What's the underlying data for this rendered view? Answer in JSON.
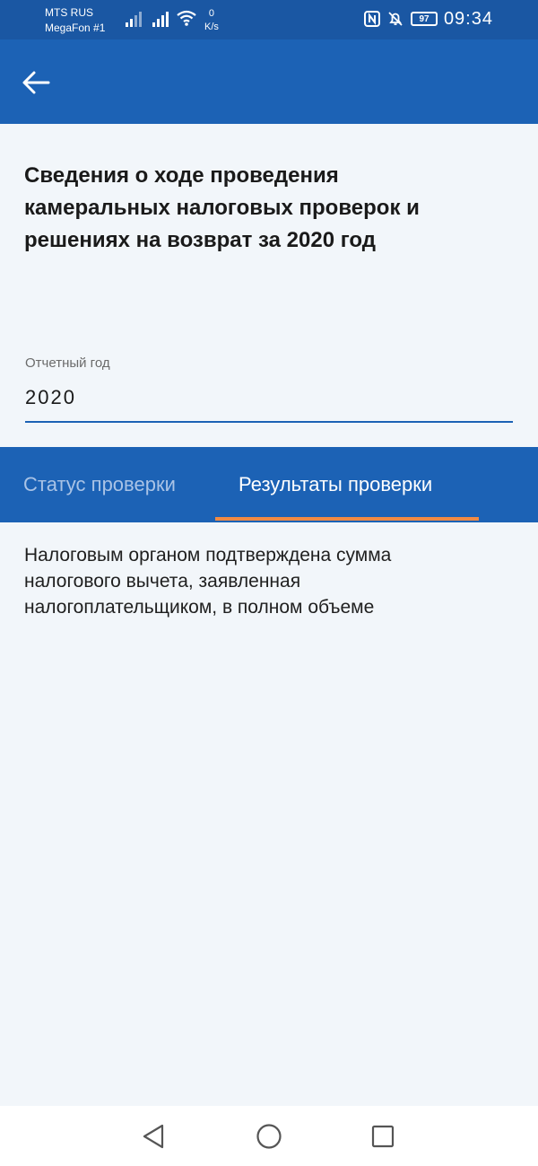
{
  "status_bar": {
    "carrier1": "MTS RUS",
    "carrier2": "MegaFon #1",
    "speed_value": "0",
    "speed_unit": "K/s",
    "battery": "97",
    "time": "09:34"
  },
  "app_bar": {
    "back_icon": "arrow-left-icon"
  },
  "page": {
    "title": "Сведения о ходе проведения камеральных налоговых проверок и решениях на возврат за 2020 год"
  },
  "report_year_field": {
    "label": "Отчетный год",
    "value": "2020"
  },
  "tabs": [
    {
      "label": "Статус проверки",
      "active": false
    },
    {
      "label": "Результаты проверки",
      "active": true
    }
  ],
  "result": {
    "text": "Налоговым органом подтверждена сумма налогового вычета, заявленная налогоплательщиком, в полном объеме"
  },
  "colors": {
    "app_bar": "#1c62b5",
    "status_bar": "#1a57a3",
    "tab_indicator": "#f08a44",
    "background": "#f2f6fa"
  },
  "nav_bar": {
    "icons": [
      "triangle-back-icon",
      "circle-home-icon",
      "square-recents-icon"
    ]
  }
}
